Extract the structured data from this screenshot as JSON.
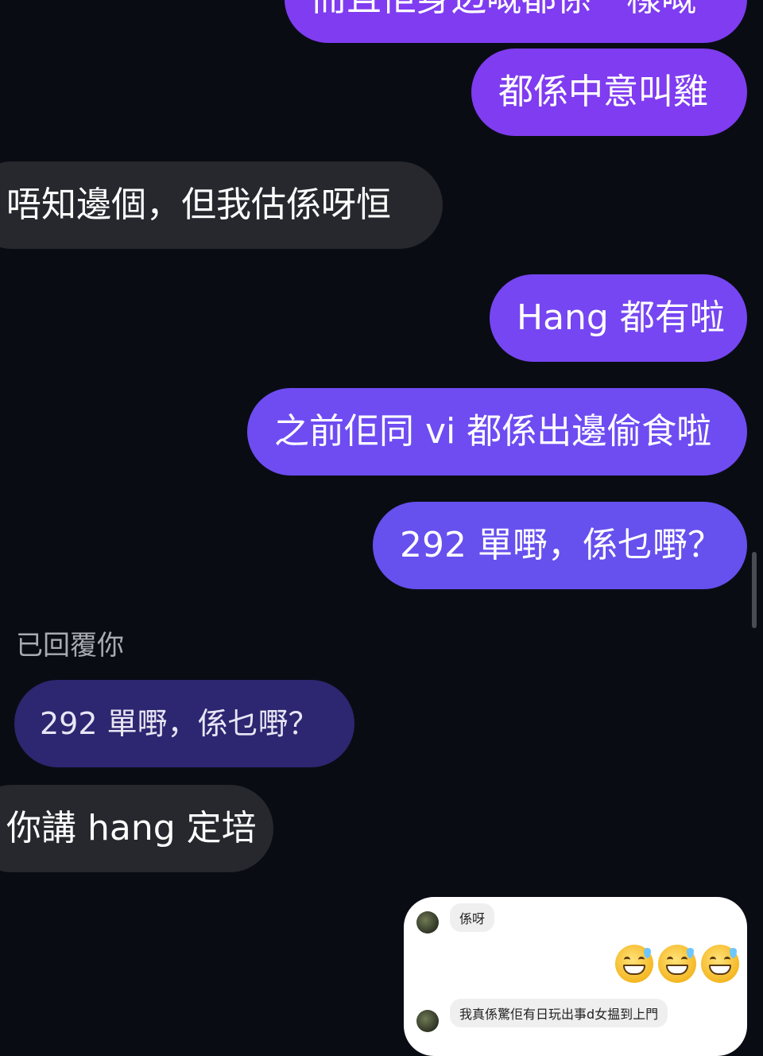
{
  "messages": {
    "m0": "而且佢身边嘅都係一樣嘅",
    "m1": "都係中意叫雞",
    "m2": "唔知邊個，但我估係呀恒",
    "m3": "Hang 都有啦",
    "m4": "之前佢同 vi 都係出邊偷食啦",
    "m5": "292 單嘢，係乜嘢？",
    "reply_label": "已回覆你",
    "quoted": "292 單嘢，係乜嘢？",
    "m6": "你講 hang 定培"
  },
  "embedded_card": {
    "msg1": "係呀",
    "emoji_icon": "grinning-sweat-face-icon",
    "emoji_count": 3,
    "msg2": "我真係驚佢有日玩出事d女揾到上門"
  },
  "colors": {
    "background": "#0a0c14",
    "outgoing_bubble": "#7c3aed",
    "incoming_bubble": "#26282e",
    "quoted_bubble": "#2d2670"
  }
}
